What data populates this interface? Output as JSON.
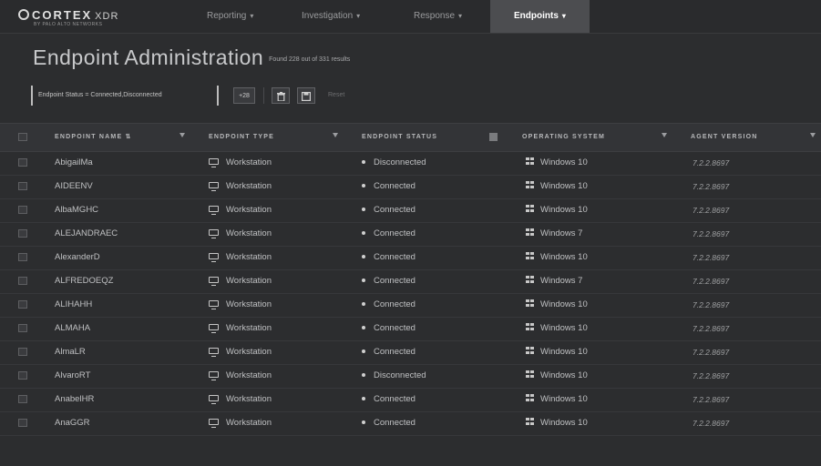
{
  "app": {
    "logo_main": "CORTEX",
    "logo_sub": "XDR",
    "logo_tagline": "BY PALO ALTO NETWORKS"
  },
  "nav": [
    {
      "label": "Reporting",
      "active": false
    },
    {
      "label": "Investigation",
      "active": false
    },
    {
      "label": "Response",
      "active": false
    },
    {
      "label": "Endpoints",
      "active": true
    }
  ],
  "page": {
    "title": "Endpoint Administration",
    "results": "Found 228 out of 331 results"
  },
  "toolbar": {
    "filter": "Endpoint Status = Connected,Disconnected",
    "more_filters": "+28",
    "delete_icon": "trash-icon",
    "save_icon": "save-icon",
    "reset": "Reset"
  },
  "table": {
    "columns": [
      {
        "label": "ENDPOINT NAME ⇅",
        "filter_active": false
      },
      {
        "label": "ENDPOINT TYPE",
        "filter_active": false
      },
      {
        "label": "ENDPOINT STATUS",
        "filter_active": true
      },
      {
        "label": "OPERATING SYSTEM",
        "filter_active": false
      },
      {
        "label": "AGENT VERSION",
        "filter_active": false
      }
    ],
    "rows": [
      {
        "name": "AbigailMa",
        "type": "Workstation",
        "status": "Disconnected",
        "os": "Windows 10",
        "version": "7.2.2.8697"
      },
      {
        "name": "AIDEENV",
        "type": "Workstation",
        "status": "Connected",
        "os": "Windows 10",
        "version": "7.2.2.8697"
      },
      {
        "name": "AlbaMGHC",
        "type": "Workstation",
        "status": "Connected",
        "os": "Windows 10",
        "version": "7.2.2.8697"
      },
      {
        "name": "ALEJANDRAEC",
        "type": "Workstation",
        "status": "Connected",
        "os": "Windows 7",
        "version": "7.2.2.8697"
      },
      {
        "name": "AlexanderD",
        "type": "Workstation",
        "status": "Connected",
        "os": "Windows 10",
        "version": "7.2.2.8697"
      },
      {
        "name": "ALFREDOEQZ",
        "type": "Workstation",
        "status": "Connected",
        "os": "Windows 7",
        "version": "7.2.2.8697"
      },
      {
        "name": "ALIHAHH",
        "type": "Workstation",
        "status": "Connected",
        "os": "Windows 10",
        "version": "7.2.2.8697"
      },
      {
        "name": "ALMAHA",
        "type": "Workstation",
        "status": "Connected",
        "os": "Windows 10",
        "version": "7.2.2.8697"
      },
      {
        "name": "AlmaLR",
        "type": "Workstation",
        "status": "Connected",
        "os": "Windows 10",
        "version": "7.2.2.8697"
      },
      {
        "name": "AlvaroRT",
        "type": "Workstation",
        "status": "Disconnected",
        "os": "Windows 10",
        "version": "7.2.2.8697"
      },
      {
        "name": "AnabelHR",
        "type": "Workstation",
        "status": "Connected",
        "os": "Windows 10",
        "version": "7.2.2.8697"
      },
      {
        "name": "AnaGGR",
        "type": "Workstation",
        "status": "Connected",
        "os": "Windows 10",
        "version": "7.2.2.8697"
      }
    ]
  }
}
